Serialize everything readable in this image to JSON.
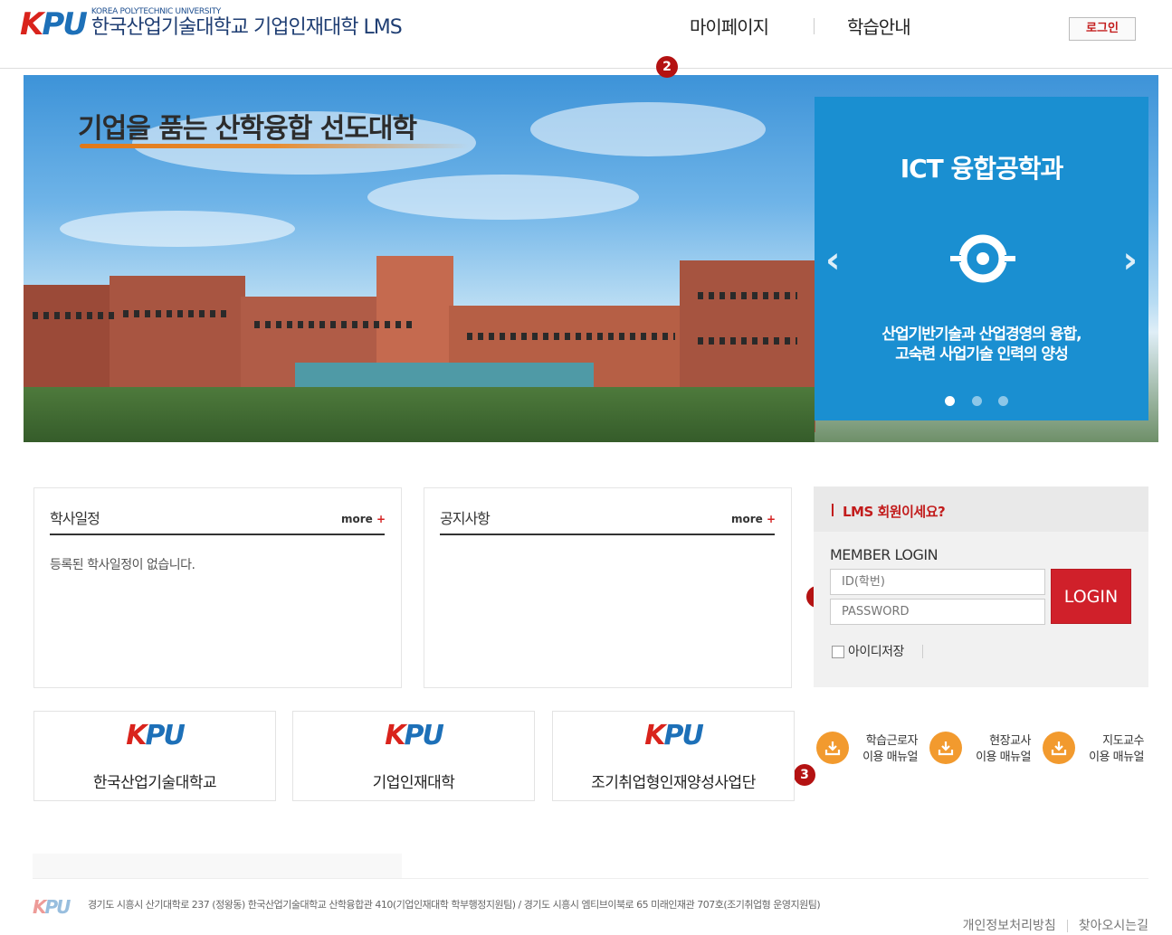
{
  "header": {
    "logo_mark": "KPU",
    "logo_sub": "KOREA POLYTECHNIC UNIVERSITY",
    "logo_title": "한국산업기술대학교 기업인재대학 LMS",
    "nav": [
      "마이페이지",
      "학습안내"
    ],
    "login_label": "로그인"
  },
  "badges": [
    "1",
    "2",
    "3"
  ],
  "banner": {
    "headline": "기업을 품는 산학융합 선도대학",
    "promo_title": "ICT 융합공학과",
    "promo_desc": [
      "산업기반기술과 산업경영의 융합,",
      "고숙련 사업기술 인력의 양성"
    ],
    "prev_glyph": "‹",
    "next_glyph": "›",
    "active_slide": 1,
    "slide_count": 3,
    "promo_color": "#1a8fd1"
  },
  "schedule": {
    "title": "학사일정",
    "more": "more",
    "empty": "등록된 학사일정이 없습니다."
  },
  "notice": {
    "title": "공지사항",
    "more": "more"
  },
  "login": {
    "question": "LMS 회원이세요?",
    "member_login": "MEMBER LOGIN",
    "id_placeholder": "ID(학번)",
    "pw_placeholder": "PASSWORD",
    "button": "LOGIN",
    "save_id": "아이디저장"
  },
  "sites": [
    {
      "logo": "KPU",
      "label": "한국산업기술대학교"
    },
    {
      "logo": "KPU",
      "label": "기업인재대학"
    },
    {
      "logo": "KPU",
      "label": "조기취업형인재양성사업단"
    }
  ],
  "manuals": [
    {
      "line1": "학습근로자",
      "line2": "이용 매뉴얼",
      "icon": "download-icon"
    },
    {
      "line1": "현장교사",
      "line2": "이용 매뉴얼",
      "icon": "download-icon"
    },
    {
      "line1": "지도교수",
      "line2": "이용 매뉴얼",
      "icon": "download-icon"
    }
  ],
  "footer": {
    "logo": "KPU",
    "address": "경기도 시흥시 산기대학로 237 (정왕동) 한국산업기술대학교 산학융합관 410(기업인재대학 학부행정지원팀) / 경기도 시흥시 엠티브이북로 65 미래인재관 707호(조기취업형 운영지원팀)",
    "links": [
      "개인정보처리방침",
      "찾아오시는길"
    ]
  },
  "colors": {
    "brand_red": "#d0202a",
    "brand_blue": "#1d70b8",
    "accent_orange": "#f29a2e"
  }
}
